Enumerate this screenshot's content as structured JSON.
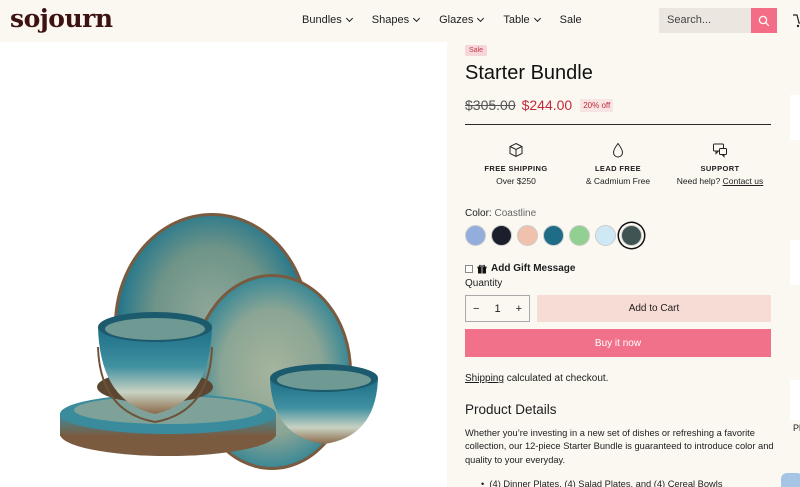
{
  "header": {
    "logo": "sojourn",
    "nav": [
      {
        "label": "Bundles",
        "dropdown": true
      },
      {
        "label": "Shapes",
        "dropdown": true
      },
      {
        "label": "Glazes",
        "dropdown": true
      },
      {
        "label": "Table",
        "dropdown": true
      },
      {
        "label": "Sale",
        "dropdown": false
      }
    ],
    "search_placeholder": "Search...",
    "search_icon": "search-icon"
  },
  "product": {
    "badge": "Sale",
    "title": "Starter Bundle",
    "price_old": "$305.00",
    "price_new": "$244.00",
    "discount": "20% off",
    "features": [
      {
        "icon": "box-icon",
        "title": "FREE SHIPPING",
        "sub": "Over $250",
        "link": ""
      },
      {
        "icon": "drop-icon",
        "title": "LEAD FREE",
        "sub": "& Cadmium Free",
        "link": ""
      },
      {
        "icon": "support-icon",
        "title": "SUPPORT",
        "sub": "Need help?",
        "link": "Contact us"
      }
    ],
    "color_label": "Color:",
    "color_value": "Coastline",
    "swatches": [
      "#93aedc",
      "#1a1f2b",
      "#f0c1ad",
      "#1f6c86",
      "#92d092",
      "#cfe8f6",
      "#3f5453"
    ],
    "selected_swatch": 6,
    "gift_label": "Add Gift Message",
    "quantity_label": "Quantity",
    "quantity": "1",
    "add_to_cart": "Add to Cart",
    "buy_now": "Buy it now",
    "shipping_link": "Shipping",
    "shipping_text": "calculated at checkout.",
    "details_title": "Product Details",
    "details_desc": "Whether you’re investing in a new set of dishes or refreshing a favorite collection, our 12-piece Starter Bundle is guaranteed to introduce color and quality to your everyday.",
    "details_bullet": "(4) Dinner Plates, (4) Salad Plates, and (4) Cereal Bowls"
  },
  "edge": {
    "text": "Pl"
  },
  "colors": {
    "accent": "#f2718a",
    "sale": "#c22a3a",
    "cart_bg": "#f7dcd5",
    "logo": "#3c1312"
  }
}
